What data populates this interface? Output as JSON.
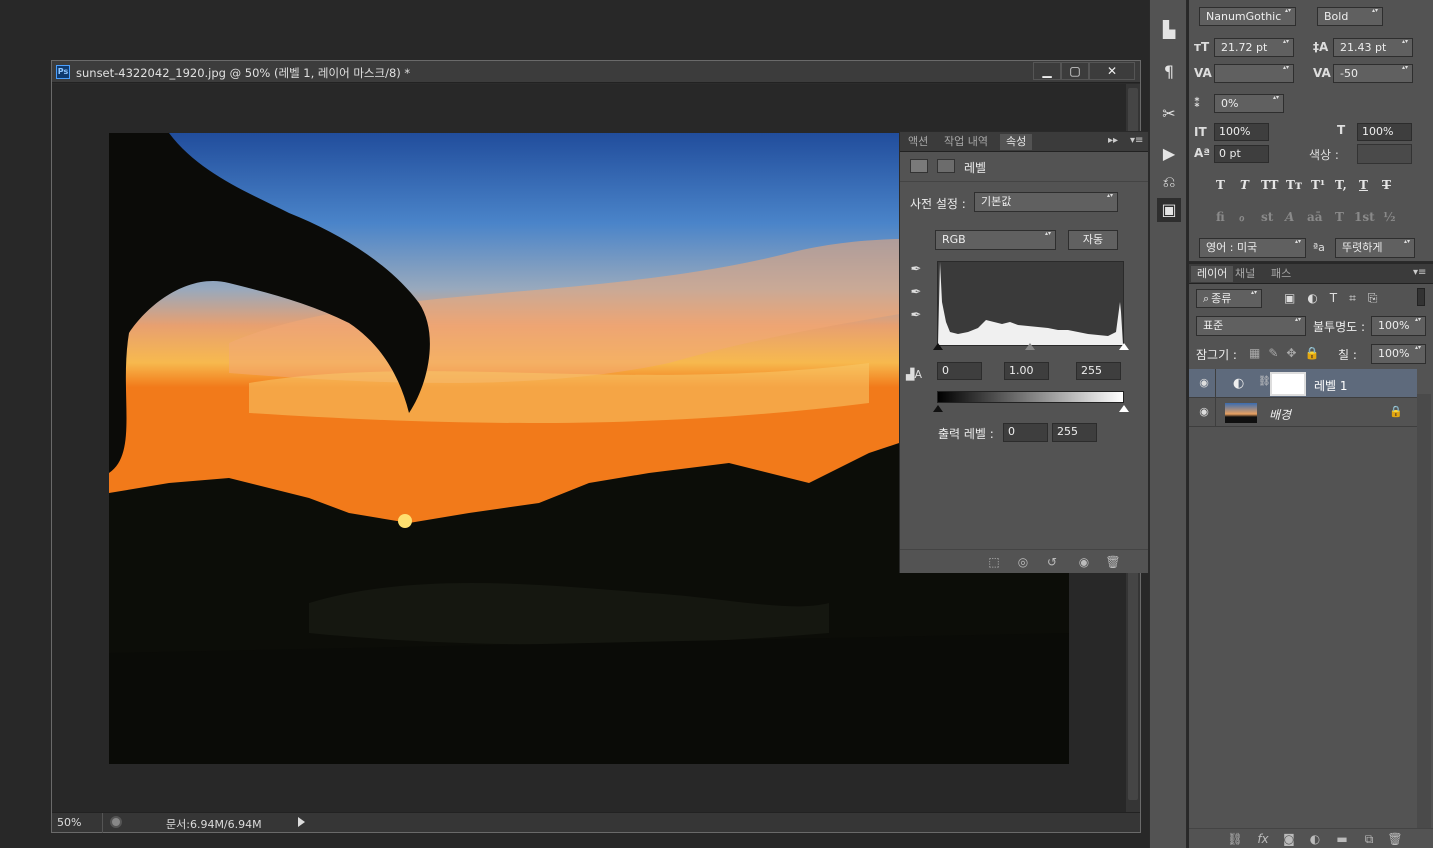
{
  "document": {
    "title": "sunset-4322042_1920.jpg @ 50% (레벨 1, 레이어 마스크/8) *",
    "window_buttons": [
      "minimize-icon",
      "maximize-icon",
      "close-icon"
    ],
    "status": {
      "zoom": "50%",
      "doc_info": "문서:6.94M/6.94M"
    }
  },
  "properties_panel": {
    "tabs": [
      "액션",
      "작업 내역",
      "속성"
    ],
    "active_tab": "속성",
    "header_label": "레벨",
    "preset_label": "사전 설정 :",
    "preset_value": "기본값",
    "channel_value": "RGB",
    "auto_button": "자동",
    "input_levels": {
      "black": "0",
      "gamma": "1.00",
      "white": "255"
    },
    "output_label": "출력 레벨 :",
    "output_levels": {
      "black": "0",
      "white": "255"
    }
  },
  "character_panel": {
    "font_family": "NanumGothic",
    "font_style": "Bold",
    "font_size": "21.72 pt",
    "leading": "21.43 pt",
    "kerning": "",
    "tracking": "-50",
    "scale_pct": "0%",
    "vertical_scale": "100%",
    "horizontal_scale": "100%",
    "baseline_shift": "0 pt",
    "color_label": "색상 :",
    "type_styles": [
      "T",
      "T",
      "TT",
      "Tт",
      "T¹",
      "T,",
      "T",
      "T"
    ],
    "opentype": [
      "fi",
      "ℴ",
      "st",
      "A",
      "aā",
      "T",
      "1st",
      "½"
    ],
    "language": "영어 : 미국",
    "aa_label": "ªa",
    "antialias": "뚜렷하게"
  },
  "layers_panel": {
    "tabs": [
      "레이어",
      "채널",
      "패스"
    ],
    "active_tab": "레이어",
    "filter_kind": "종류",
    "blend_mode": "표준",
    "opacity_label": "불투명도 :",
    "opacity": "100%",
    "lock_label": "잠그기 :",
    "fill_label": "칠 :",
    "fill": "100%",
    "layers": [
      {
        "name": "레벨 1",
        "selected": true
      },
      {
        "name": "배경",
        "selected": false
      }
    ]
  },
  "colors": {
    "panel_bg": "#535353",
    "selected_layer": "#5e6a7c",
    "canvas": "#282828"
  }
}
